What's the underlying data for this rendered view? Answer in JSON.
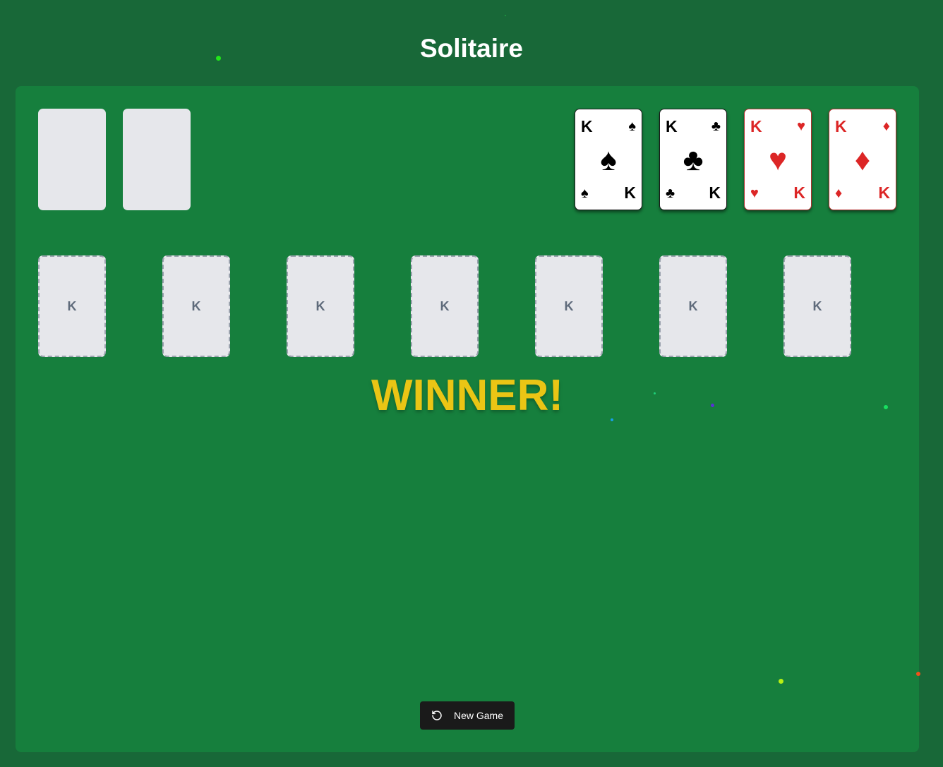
{
  "title": "Solitaire",
  "foundations": [
    {
      "rank": "K",
      "suit": "♠",
      "color": "black",
      "suit_name": "spades"
    },
    {
      "rank": "K",
      "suit": "♣",
      "color": "black",
      "suit_name": "clubs"
    },
    {
      "rank": "K",
      "suit": "♥",
      "color": "red",
      "suit_name": "hearts"
    },
    {
      "rank": "K",
      "suit": "♦",
      "color": "red",
      "suit_name": "diamonds"
    }
  ],
  "tableau_placeholder": "K",
  "winner_text": "WINNER!",
  "new_game_label": "New Game",
  "icons": {
    "new_game": "rotate-ccw-icon"
  },
  "colors": {
    "background": "#186838",
    "board": "#167f3d",
    "winner": "#eac515",
    "card_red": "#dc2626",
    "card_black": "#000000"
  }
}
